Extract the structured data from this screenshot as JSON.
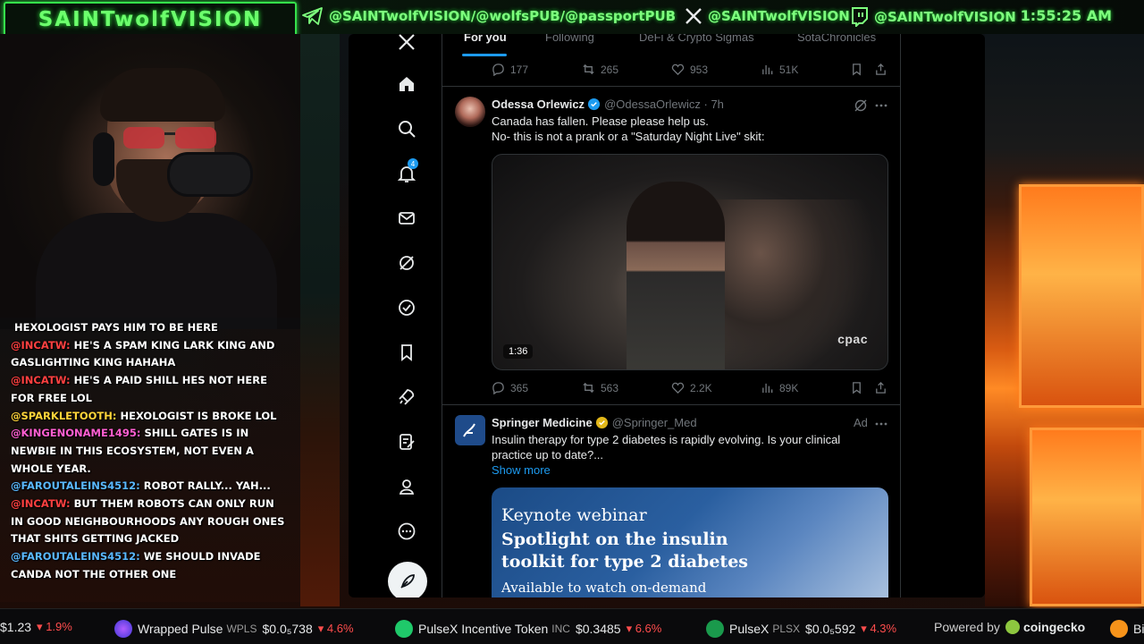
{
  "overlay": {
    "brand": "SAINTwolfVISION",
    "telegram_handle": "@SAINTwolfVISION/@wolfsPUB/@passportPUB",
    "x_handle": "@SAINTwolfVISION",
    "twitch_handle": "@SAINTwolfVISION",
    "clock": "1:55:25 AM",
    "brand_color": "#6cff6c"
  },
  "chat": [
    {
      "user": "",
      "text": "HEXOLOGIST PAYS HIM TO BE HERE",
      "color": "#ffffff"
    },
    {
      "user": "@INCATW:",
      "text": "HE'S A SPAM KING LARK KING AND GASLIGHTING KING HAHAHA",
      "color": "#ff4040"
    },
    {
      "user": "@INCATW:",
      "text": "HE'S A PAID SHILL HES NOT HERE FOR FREE LOL",
      "color": "#ff4040"
    },
    {
      "user": "@SPARKLETOOTH:",
      "text": "HEXOLOGIST IS BROKE LOL",
      "color": "#ffd43a"
    },
    {
      "user": "@KINGENONAME1495:",
      "text": "SHILL GATES IS IN NEWBIE IN THIS ECOSYSTEM, NOT EVEN A WHOLE YEAR.",
      "color": "#ff5fd2"
    },
    {
      "user": "@FAROUTALEINS4512:",
      "text": "ROBOT RALLY... YAH...",
      "color": "#5ab8ff"
    },
    {
      "user": "@INCATW:",
      "text": "BUT THEM ROBOTS CAN ONLY RUN IN GOOD NEIGHBOURHOODS ANY ROUGH ONES THAT SHITS GETTING JACKED",
      "color": "#ff4040"
    },
    {
      "user": "@FAROUTALEINS4512:",
      "text": "WE SHOULD INVADE CANDA NOT THE OTHER ONE",
      "color": "#5ab8ff"
    }
  ],
  "x": {
    "tabs": [
      "For you",
      "Following",
      "DeFi & Crypto Sigmas",
      "SotaChronicles"
    ],
    "notification_count": "4",
    "top_actions": {
      "replies": "177",
      "reposts": "265",
      "likes": "953",
      "views": "51K"
    },
    "post1": {
      "name": "Odessa Orlewicz",
      "handle": "@OdessaOrlewicz · 7h",
      "line1": "Canada has fallen. Please please help us.",
      "line2": "No- this is not a prank or a \"Saturday Night Live\" skit:",
      "duration": "1:36",
      "watermark": "cpac",
      "replies": "365",
      "reposts": "563",
      "likes": "2.2K",
      "views": "89K"
    },
    "post2": {
      "name": "Springer Medicine",
      "handle": "@Springer_Med",
      "ad_label": "Ad",
      "line1": "Insulin therapy for type 2 diabetes is rapidly evolving. Is your clinical",
      "line2": "practice up to date?...",
      "show_more": "Show more",
      "img_line1": "Keynote webinar",
      "img_line2": "Spotlight on the insulin",
      "img_line3": "toolkit for type 2 diabetes",
      "img_line4": "Available to watch on-demand"
    }
  },
  "ticker": {
    "item0_price": "$1.23",
    "item0_chg": "1.9%",
    "item1_name": "Wrapped Pulse",
    "item1_sym": "WPLS",
    "item1_price": "$0.0₅738",
    "item1_chg": "4.6%",
    "item2_name": "PulseX Incentive Token",
    "item2_sym": "INC",
    "item2_price": "$0.3485",
    "item2_chg": "6.6%",
    "item3_name": "PulseX",
    "item3_sym": "PLSX",
    "item3_price": "$0.0₅592",
    "item3_chg": "4.3%",
    "powered": "Powered by",
    "coingecko": "coingecko",
    "item4_name": "Bi"
  }
}
